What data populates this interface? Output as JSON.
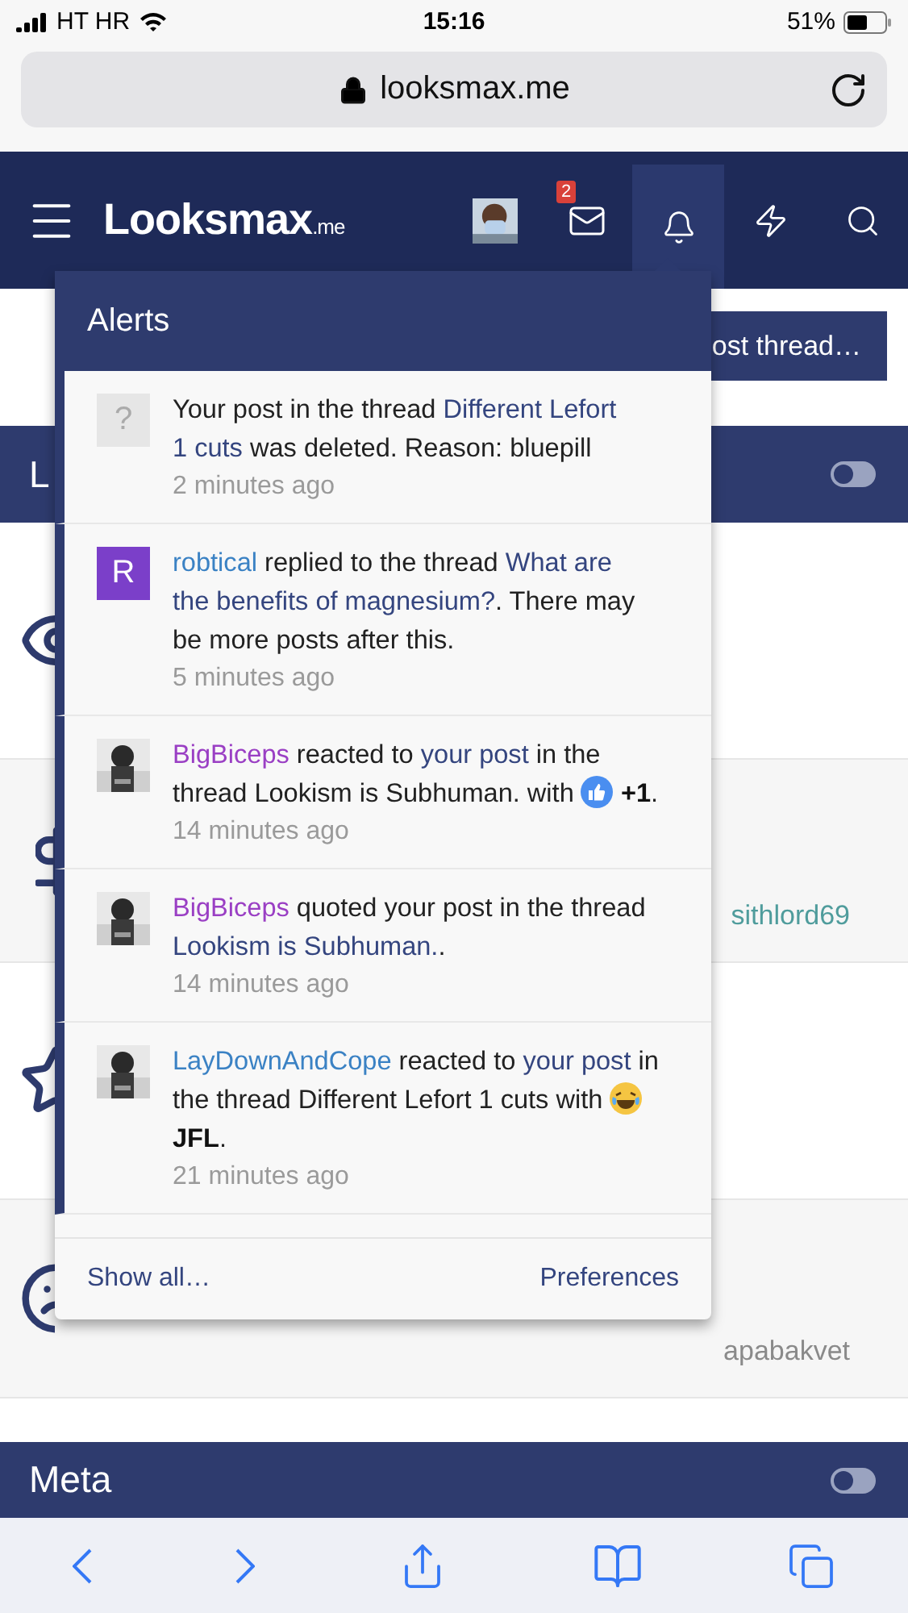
{
  "status_bar": {
    "carrier": "HT HR",
    "time": "15:16",
    "battery": "51%"
  },
  "address_bar": {
    "url": "looksmax.me"
  },
  "nav": {
    "logo": {
      "name": "Looksmax",
      "suffix": ".me"
    },
    "inbox_badge": "2",
    "alerts_open": true
  },
  "post_thread_button": "ost thread…",
  "sections": [
    {
      "title": "L",
      "on": false,
      "rows": [
        {
          "kind": "eye"
        },
        {
          "kind": "dollar",
          "user": "sithlord69",
          "color": "#4f9c9c"
        },
        {
          "kind": "star"
        },
        {
          "kind": "face",
          "user": "apabakvet",
          "color": "#8a8a8a"
        }
      ]
    },
    {
      "title": "Meta",
      "on": false
    }
  ],
  "alerts": {
    "title": "Alerts",
    "items": [
      {
        "unread": true,
        "avatar": {
          "kind": "placeholder",
          "text": "?"
        },
        "message": [
          {
            "kind": "text",
            "text": "Your post in the thread "
          },
          {
            "kind": "link",
            "text": "Different Lefort"
          },
          {
            "kind": "link",
            "text": "1 cuts"
          },
          {
            "kind": "text",
            "text": " was deleted. Reason: bluepill"
          }
        ],
        "time": "2 minutes ago"
      },
      {
        "unread": true,
        "avatar": {
          "kind": "letter",
          "text": "R",
          "color": "#7b3fc9"
        },
        "message": [
          {
            "kind": "user",
            "text": "robtical",
            "color": "#3b82c4"
          },
          {
            "kind": "text",
            "text": " replied to the thread "
          },
          {
            "kind": "link",
            "text": "What are"
          },
          {
            "kind": "link",
            "text": "the benefits of magnesium?"
          },
          {
            "kind": "text",
            "text": ". There may be more posts after this."
          }
        ],
        "time": "5 minutes ago"
      },
      {
        "unread": true,
        "avatar": {
          "kind": "picture"
        },
        "message": [
          {
            "kind": "user",
            "text": "BigBiceps",
            "color": "#9a3fc4"
          },
          {
            "kind": "text",
            "text": " reacted to "
          },
          {
            "kind": "link",
            "text": "your post"
          },
          {
            "kind": "text",
            "text": " in the thread Lookism is Subhuman. with "
          },
          {
            "kind": "like",
            "text": "+1"
          },
          {
            "kind": "text",
            "text": "."
          }
        ],
        "time": "14 minutes ago"
      },
      {
        "unread": true,
        "avatar": {
          "kind": "picture"
        },
        "message": [
          {
            "kind": "user",
            "text": "BigBiceps",
            "color": "#9a3fc4"
          },
          {
            "kind": "text",
            "text": " quoted your post in the thread "
          },
          {
            "kind": "link",
            "text": "Lookism is Subhuman."
          },
          {
            "kind": "text",
            "text": "."
          }
        ],
        "time": "14 minutes ago"
      },
      {
        "unread": true,
        "avatar": {
          "kind": "picture"
        },
        "message": [
          {
            "kind": "user",
            "text": "LayDownAndCope",
            "color": "#3b82c4"
          },
          {
            "kind": "text",
            "text": " reacted to "
          },
          {
            "kind": "link",
            "text": "your post"
          },
          {
            "kind": "text",
            "text": " in the thread Different Lefort 1 cuts with "
          },
          {
            "kind": "laugh",
            "text": "JFL"
          },
          {
            "kind": "text",
            "text": "."
          }
        ],
        "time": "21 minutes ago"
      }
    ],
    "footer": {
      "show_all": "Show all…",
      "preferences": "Preferences"
    }
  }
}
